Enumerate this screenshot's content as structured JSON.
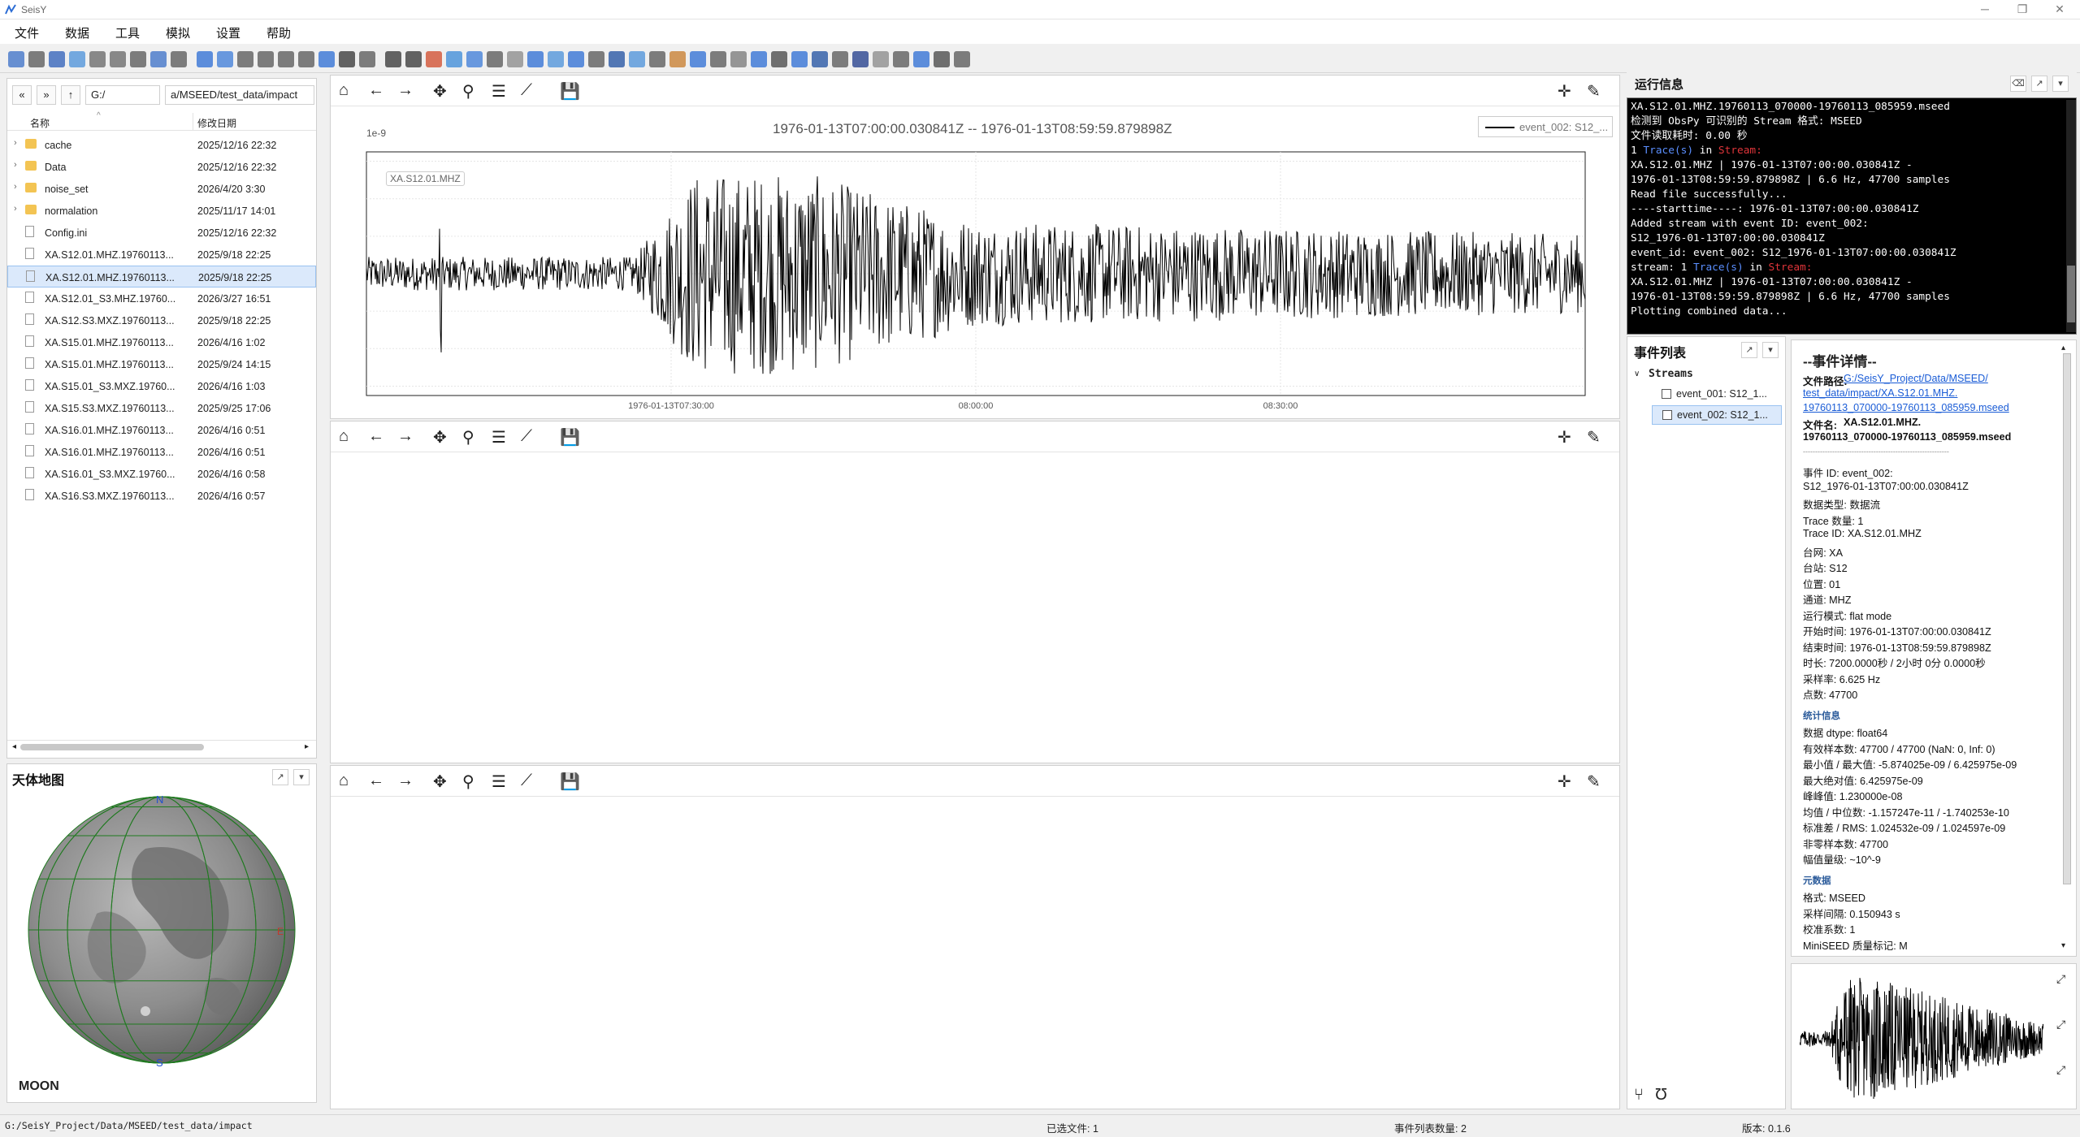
{
  "app": {
    "title": "SeisY"
  },
  "window_controls": {
    "minimize": "─",
    "maximize": "❐",
    "close": "✕"
  },
  "menu": [
    "文件",
    "数据",
    "工具",
    "模拟",
    "设置",
    "帮助"
  ],
  "file_browser": {
    "nav": {
      "back": "«",
      "forward": "»",
      "up": "↑"
    },
    "drive": "G:/",
    "path": "a/MSEED/test_data/impact",
    "columns": {
      "name": "名称",
      "modified": "修改日期"
    },
    "rows": [
      {
        "name": "cache",
        "date": "2025/12/16 22:32",
        "type": "folder"
      },
      {
        "name": "Data",
        "date": "2025/12/16 22:32",
        "type": "folder"
      },
      {
        "name": "noise_set",
        "date": "2026/4/20 3:30",
        "type": "folder"
      },
      {
        "name": "normalation",
        "date": "2025/11/17 14:01",
        "type": "folder"
      },
      {
        "name": "Config.ini",
        "date": "2025/12/16 22:32",
        "type": "file"
      },
      {
        "name": "XA.S12.01.MHZ.19760113...",
        "date": "2025/9/18 22:25",
        "type": "file"
      },
      {
        "name": "XA.S12.01.MHZ.19760113...",
        "date": "2025/9/18 22:25",
        "type": "file",
        "selected": true
      },
      {
        "name": "XA.S12.01_S3.MHZ.19760...",
        "date": "2026/3/27 16:51",
        "type": "file"
      },
      {
        "name": "XA.S12.S3.MXZ.19760113...",
        "date": "2025/9/18 22:25",
        "type": "file"
      },
      {
        "name": "XA.S15.01.MHZ.19760113...",
        "date": "2026/4/16 1:02",
        "type": "file"
      },
      {
        "name": "XA.S15.01.MHZ.19760113...",
        "date": "2025/9/24 14:15",
        "type": "file"
      },
      {
        "name": "XA.S15.01_S3.MXZ.19760...",
        "date": "2026/4/16 1:03",
        "type": "file"
      },
      {
        "name": "XA.S15.S3.MXZ.19760113...",
        "date": "2025/9/25 17:06",
        "type": "file"
      },
      {
        "name": "XA.S16.01.MHZ.19760113...",
        "date": "2026/4/16 0:51",
        "type": "file"
      },
      {
        "name": "XA.S16.01.MHZ.19760113...",
        "date": "2026/4/16 0:51",
        "type": "file"
      },
      {
        "name": "XA.S16.01_S3.MXZ.19760...",
        "date": "2026/4/16 0:58",
        "type": "file"
      },
      {
        "name": "XA.S16.S3.MXZ.19760113...",
        "date": "2026/4/16 0:57",
        "type": "file"
      }
    ]
  },
  "map_panel": {
    "title": "天体地图",
    "body_label": "MOON",
    "north": "N",
    "south": "S",
    "east": "E"
  },
  "plot1": {
    "title": "1976-01-13T07:00:00.030841Z -- 1976-01-13T08:59:59.879898Z",
    "exponent": "1e-9",
    "trace_label": "XA.S12.01.MHZ",
    "legend": "event_002: S12_...",
    "chart_data": {
      "type": "line",
      "series": [
        {
          "name": "event_002: S12_..."
        }
      ],
      "ylim": [
        -6.5,
        6.5
      ],
      "yticks": [
        6,
        4,
        2,
        0,
        -2,
        -4,
        -6
      ],
      "xticks": [
        "1976-01-13T07:30:00",
        "08:00:00",
        "08:30:00"
      ],
      "xtick_fracs": [
        0.25,
        0.5,
        0.75
      ],
      "samples": 47700,
      "min": -5.874025e-09,
      "max": 6.425975e-09,
      "grid": true
    }
  },
  "run_info": {
    "title": "运行信息",
    "lines": [
      "XA.S12.01.MHZ.19760113_070000-19760113_085959.mseed",
      "检测到 ObsPy 可识别的 Stream 格式: MSEED",
      "文件读取耗时: 0.00 秒",
      "1 Trace(s) in Stream:",
      "XA.S12.01.MHZ | 1976-01-13T07:00:00.030841Z -",
      "1976-01-13T08:59:59.879898Z | 6.6 Hz, 47700 samples",
      "Read file successfully...",
      "----starttime----: 1976-01-13T07:00:00.030841Z",
      "Added stream with event ID: event_002:",
      "S12_1976-01-13T07:00:00.030841Z",
      "event_id: event_002: S12_1976-01-13T07:00:00.030841Z",
      "stream: 1 Trace(s) in Stream:",
      "XA.S12.01.MHZ | 1976-01-13T07:00:00.030841Z -",
      "1976-01-13T08:59:59.879898Z | 6.6 Hz, 47700 samples",
      "Plotting combined data..."
    ]
  },
  "event_list": {
    "title": "事件列表",
    "group": "Streams",
    "items": [
      "event_001: S12_1...",
      "event_002: S12_1..."
    ]
  },
  "detail": {
    "title": "--事件详情--",
    "path_label": "文件路径:",
    "path_l1": "G:/SeisY_Project/Data/MSEED/",
    "path_l2": "test_data/impact/XA.S12.01.MHZ.",
    "path_l3": "19760113_070000-19760113_085959.mseed",
    "name_label": "文件名:",
    "name_l1": "XA.S12.01.MHZ.",
    "name_l2": "19760113_070000-19760113_085959.mseed",
    "sep": "------------------------------------------------------------",
    "lines": [
      "事件 ID: event_002:",
      "S12_1976-01-13T07:00:00.030841Z",
      "数据类型: 数据流",
      "Trace 数量: 1",
      "Trace ID: XA.S12.01.MHZ",
      "台网: XA",
      "台站: S12",
      "位置: 01",
      "通道: MHZ",
      "运行模式: flat mode",
      "开始时间: 1976-01-13T07:00:00.030841Z",
      "结束时间: 1976-01-13T08:59:59.879898Z",
      "时长: 7200.0000秒 / 2小时 0分 0.0000秒",
      "采样率: 6.625 Hz",
      "点数: 47700"
    ],
    "stats_head": "统计信息",
    "stats": [
      "数据 dtype: float64",
      "有效样本数: 47700 / 47700 (NaN: 0, Inf: 0)",
      "最小值 / 最大值: -5.874025e-09 / 6.425975e-09",
      "最大绝对值: 6.425975e-09",
      "峰峰值: 1.230000e-08",
      "均值 / 中位数: -1.157247e-11 / -1.740253e-10",
      "标准差 / RMS: 1.024532e-09 / 1.024597e-09",
      "非零样本数: 47700",
      "幅值量级: ~10^-9"
    ],
    "meta_head": "元数据",
    "meta": [
      "格式: MSEED",
      "采样间隔: 0.150943 s",
      "校准系数: 1",
      "MiniSEED 质量标记: M"
    ]
  },
  "status": {
    "path": "G:/SeisY_Project/Data/MSEED/test_data/impact",
    "selected": "已选文件: 1",
    "events": "事件列表数量: 2",
    "version": "版本: 0.1.6"
  }
}
